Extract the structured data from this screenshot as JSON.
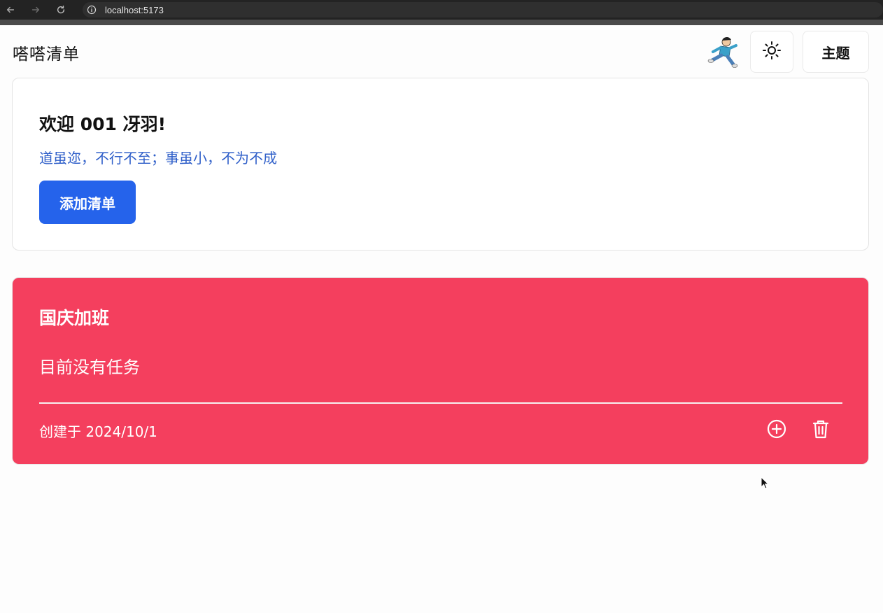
{
  "browser": {
    "url": "localhost:5173",
    "icons": [
      "back-arrow-icon",
      "forward-arrow-icon",
      "reload-icon",
      "info-icon"
    ]
  },
  "header": {
    "title": "嗒嗒清单",
    "theme_label": "主题",
    "icons": {
      "avatar": "running-man-avatar",
      "toggle": "sun-icon"
    }
  },
  "welcome": {
    "title": "欢迎 001 冴羽!",
    "motto": "道虽迩，不行不至；事虽小，不为不成",
    "add_label": "添加清单",
    "colors": {
      "accent": "#2563eb",
      "motto": "#2f5fc9"
    }
  },
  "lists": [
    {
      "title": "国庆加班",
      "empty_text": "目前没有任务",
      "created": "创建于 2024/10/1",
      "color": "#f43f5e",
      "icons": {
        "add": "plus-circle-icon",
        "delete": "trash-icon"
      }
    }
  ]
}
